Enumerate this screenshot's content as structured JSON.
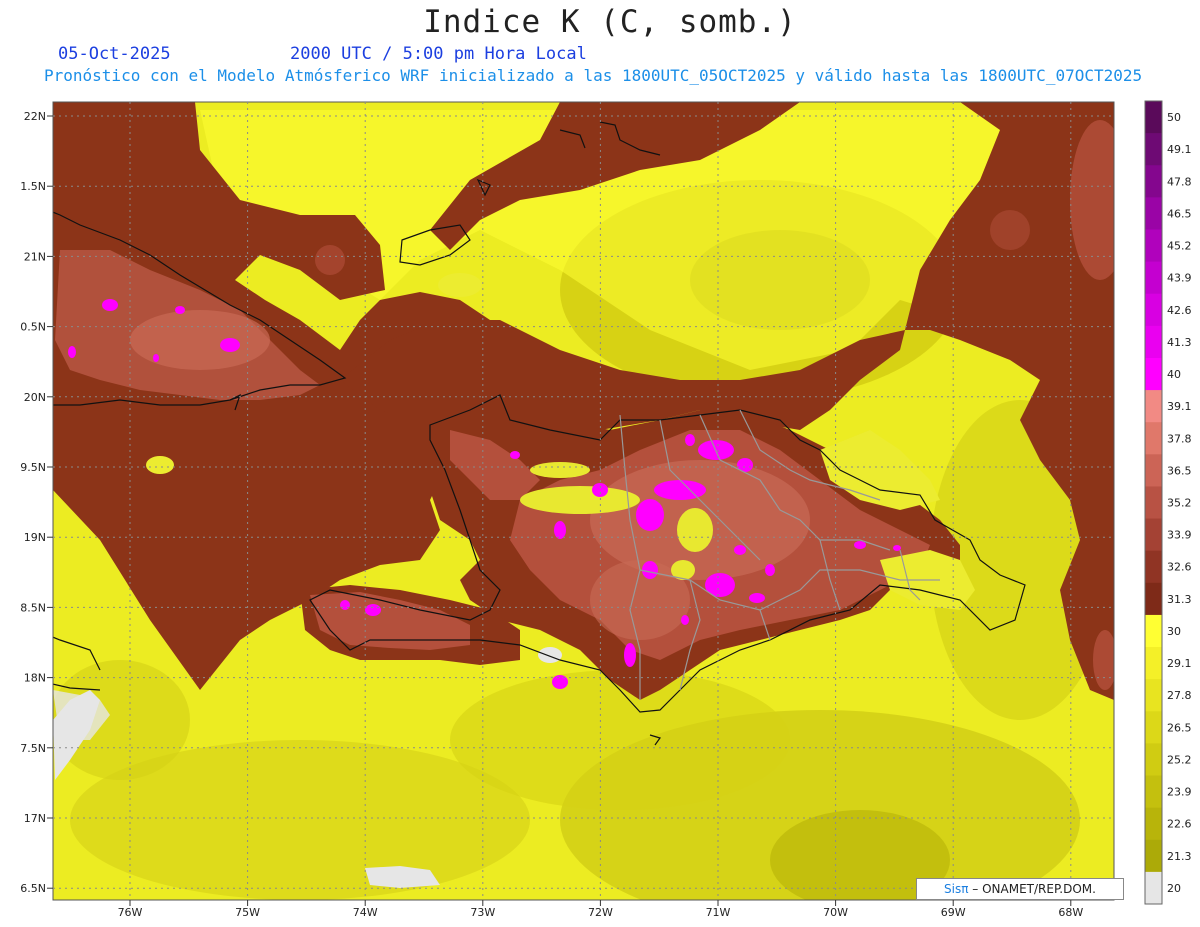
{
  "header": {
    "title": "Indice K (C, somb.)",
    "date": "05-Oct-2025",
    "time": "2000 UTC / 5:00 pm Hora Local",
    "description": "Pronóstico con el Modelo Atmósferico WRF inicializado a las 1800UTC_05OCT2025 y válido hasta las  1800UTC_07OCT2025"
  },
  "axes": {
    "lat_labels": [
      "22N",
      "1.5N",
      "21N",
      "0.5N",
      "20N",
      "9.5N",
      "19N",
      "8.5N",
      "18N",
      "7.5N",
      "17N",
      "6.5N"
    ],
    "lon_labels": [
      "76W",
      "75W",
      "74W",
      "73W",
      "72W",
      "71W",
      "70W",
      "69W",
      "68W"
    ]
  },
  "colorbar": {
    "levels": [
      "50",
      "49.1",
      "47.8",
      "46.5",
      "45.2",
      "43.9",
      "42.6",
      "41.3",
      "40",
      "39.1",
      "37.8",
      "36.5",
      "35.2",
      "33.9",
      "32.6",
      "31.3",
      "30",
      "29.1",
      "27.8",
      "26.5",
      "25.2",
      "23.9",
      "22.6",
      "21.3",
      "20"
    ],
    "colors": [
      "#5a0a5a",
      "#6e0a74",
      "#84068e",
      "#9a04a6",
      "#b002bc",
      "#c400d0",
      "#d800e2",
      "#ea00f0",
      "#ff00ff",
      "#f28a84",
      "#e0786a",
      "#cc6456",
      "#b85244",
      "#a44234",
      "#903424",
      "#7e2a18",
      "#ffff33",
      "#f4f028",
      "#e8e420",
      "#dcd818",
      "#d0cc12",
      "#c4c00e",
      "#b8b40a",
      "#acaa08",
      "#e6e6e6"
    ]
  },
  "credit": {
    "brand": "Sisπ",
    "org": " – ONAMET/REP.DOM."
  }
}
